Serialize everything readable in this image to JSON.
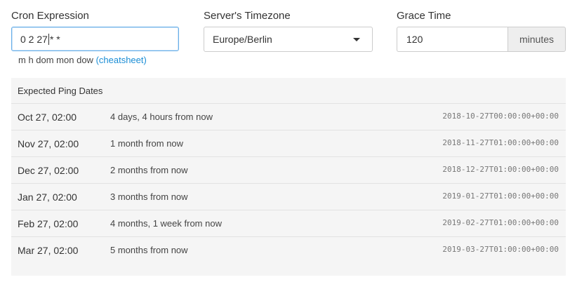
{
  "cron": {
    "label": "Cron Expression",
    "value_before_caret": "0 2 27",
    "value_after_caret": "* *",
    "hint_fields": "m h dom mon dow",
    "hint_link": "(cheatsheet)"
  },
  "timezone": {
    "label": "Server's Timezone",
    "value": "Europe/Berlin"
  },
  "grace": {
    "label": "Grace Time",
    "value": "120",
    "unit": "minutes"
  },
  "expected": {
    "title": "Expected Ping Dates",
    "rows": [
      {
        "date": "Oct 27, 02:00",
        "relative": "4 days, 4 hours from now",
        "iso": "2018-10-27T00:00:00+00:00"
      },
      {
        "date": "Nov 27, 02:00",
        "relative": "1 month from now",
        "iso": "2018-11-27T01:00:00+00:00"
      },
      {
        "date": "Dec 27, 02:00",
        "relative": "2 months from now",
        "iso": "2018-12-27T01:00:00+00:00"
      },
      {
        "date": "Jan 27, 02:00",
        "relative": "3 months from now",
        "iso": "2019-01-27T01:00:00+00:00"
      },
      {
        "date": "Feb 27, 02:00",
        "relative": "4 months, 1 week from now",
        "iso": "2019-02-27T01:00:00+00:00"
      },
      {
        "date": "Mar 27, 02:00",
        "relative": "5 months from now",
        "iso": "2019-03-27T01:00:00+00:00"
      }
    ]
  },
  "colors": {
    "accent": "#1a8dd5",
    "focus_border": "#66afe9",
    "panel_bg": "#f5f5f5"
  }
}
